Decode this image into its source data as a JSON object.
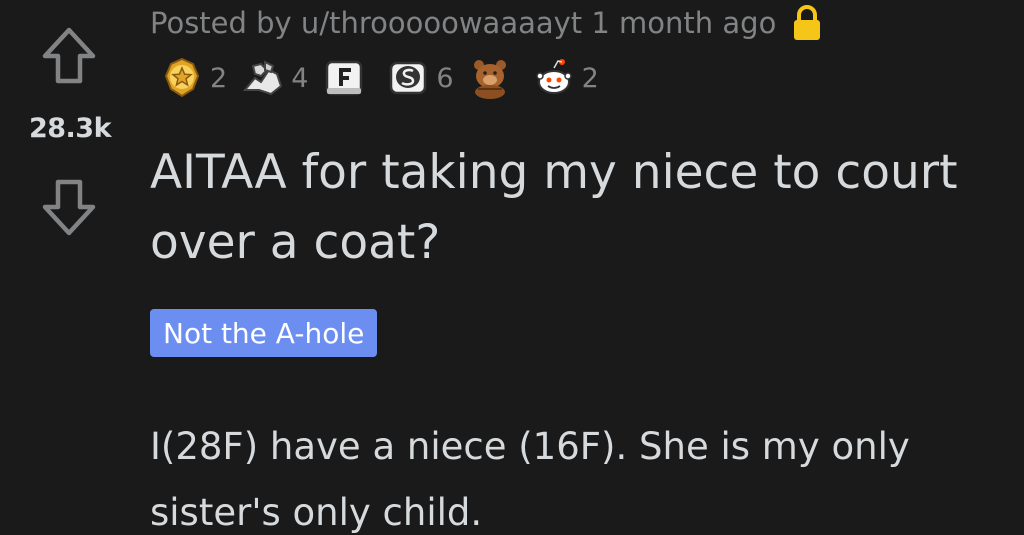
{
  "post": {
    "meta": {
      "posted_by": "Posted by u/throoooowaaaayt 1 month ago"
    },
    "score": "28.3k",
    "awards": [
      {
        "icon": "gold-star-award-icon",
        "count": "2"
      },
      {
        "icon": "arm-wrestle-award-icon",
        "count": "4"
      },
      {
        "icon": "press-f-award-icon",
        "count": ""
      },
      {
        "icon": "s-keycap-award-icon",
        "count": "6"
      },
      {
        "icon": "bear-award-icon",
        "count": ""
      },
      {
        "icon": "snoo-award-icon",
        "count": "2"
      }
    ],
    "title": "AITAA for taking my niece to court over a coat?",
    "flair": "Not the A-hole",
    "body": "I(28F) have a niece (16F). She is my only sister's only child."
  },
  "colors": {
    "background": "#1a1a1b",
    "text": "#d7dadc",
    "muted": "#818384",
    "flair_bg": "#6b8ef0",
    "lock": "#f5c518"
  }
}
